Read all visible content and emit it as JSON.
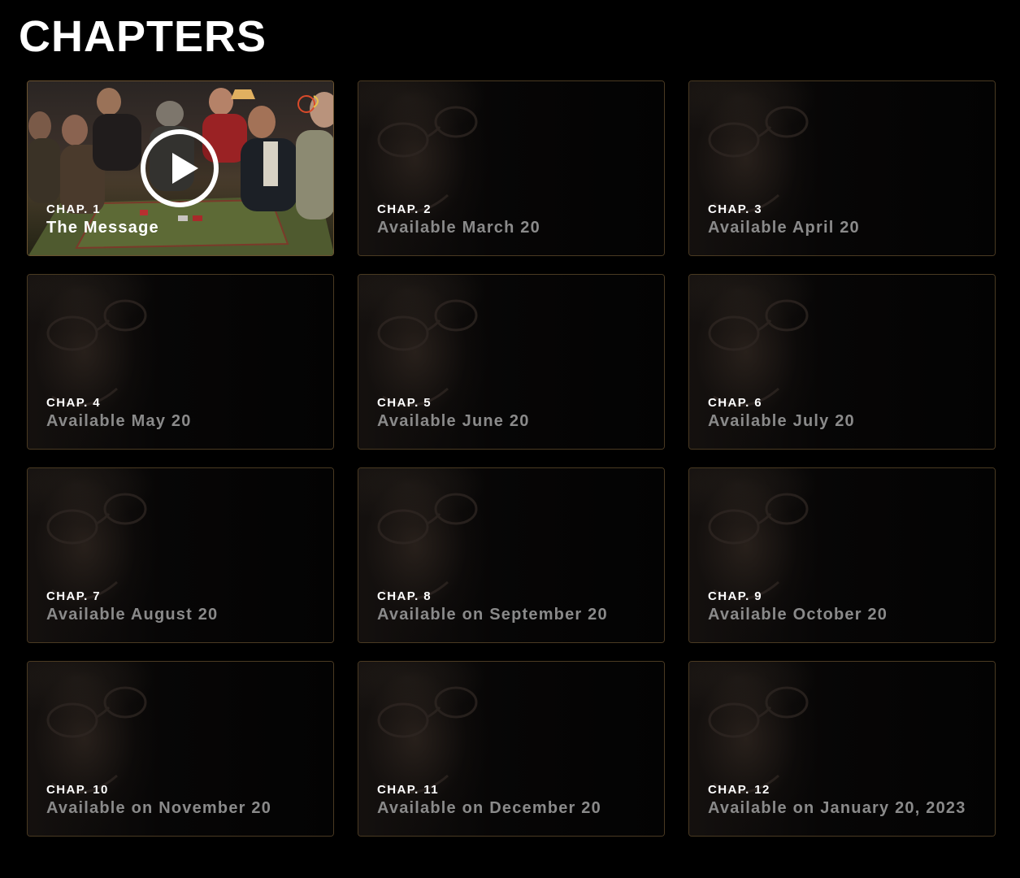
{
  "header": {
    "title": "CHAPTERS"
  },
  "chapters": [
    {
      "label": "CHAP. 1",
      "title": "The Message",
      "available": true
    },
    {
      "label": "CHAP. 2",
      "title": "Available March 20",
      "available": false
    },
    {
      "label": "CHAP. 3",
      "title": "Available April 20",
      "available": false
    },
    {
      "label": "CHAP. 4",
      "title": "Available May 20",
      "available": false
    },
    {
      "label": "CHAP. 5",
      "title": "Available June 20",
      "available": false
    },
    {
      "label": "CHAP. 6",
      "title": "Available July 20",
      "available": false
    },
    {
      "label": "CHAP. 7",
      "title": "Available August 20",
      "available": false
    },
    {
      "label": "CHAP. 8",
      "title": "Available on September 20",
      "available": false
    },
    {
      "label": "CHAP. 9",
      "title": "Available October 20",
      "available": false
    },
    {
      "label": "CHAP. 10",
      "title": "Available on November 20",
      "available": false
    },
    {
      "label": "CHAP. 11",
      "title": "Available on December 20",
      "available": false
    },
    {
      "label": "CHAP. 12",
      "title": "Available on January 20, 2023",
      "available": false
    }
  ],
  "icons": {
    "play": "play-icon"
  },
  "colors": {
    "background": "#000000",
    "card_border": "#4a3a22",
    "title_text": "#ffffff",
    "locked_text": "#8a8a8a"
  }
}
